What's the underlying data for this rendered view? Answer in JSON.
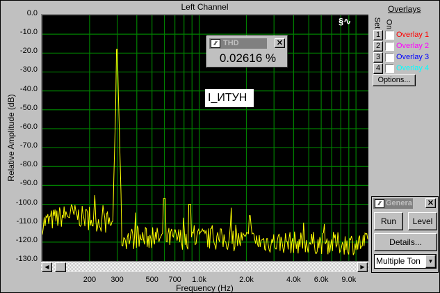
{
  "window": {
    "title": "Left Channel"
  },
  "axes": {
    "y_title": "Relative Amplitude (dB)",
    "x_title": "Frequency (Hz)",
    "y_ticks": [
      "0.0",
      "-10.0",
      "-20.0",
      "-30.0",
      "-40.0",
      "-50.0",
      "-60.0",
      "-70.0",
      "-80.0",
      "-90.0",
      "-100.0",
      "-110.0",
      "-120.0",
      "-130.0"
    ],
    "x_ticks": [
      "200",
      "300",
      "500",
      "700",
      "1.0k",
      "2.0k",
      "4.0k",
      "6.0k",
      "9.0k"
    ]
  },
  "thd": {
    "title": "THD",
    "value": "0.02616 %"
  },
  "marker_label": "I_ИТУН",
  "overlays": {
    "title": "Overlays",
    "set_label": "Set",
    "on_label": "On",
    "options_label": "Options...",
    "items": [
      {
        "num": "1",
        "name": "Overlay 1",
        "color": "#ff0000"
      },
      {
        "num": "2",
        "name": "Overlay 2",
        "color": "#ff00ff"
      },
      {
        "num": "3",
        "name": "Overlay 3",
        "color": "#0000ff"
      },
      {
        "num": "4",
        "name": "Overlay 4",
        "color": "#00ffff"
      }
    ]
  },
  "generator": {
    "title": "Genera",
    "run": "Run",
    "level": "Level",
    "details": "Details...",
    "waveform": "Multiple Ton"
  },
  "chart_data": {
    "type": "line",
    "title": "Left Channel",
    "xlabel": "Frequency (Hz)",
    "ylabel": "Relative Amplitude (dB)",
    "xscale": "log",
    "xlim": [
      100,
      12000
    ],
    "ylim": [
      -130,
      0
    ],
    "grid": true,
    "line_color": "#ffff00",
    "noise_floor": [
      [
        100,
        -110
      ],
      [
        150,
        -105
      ],
      [
        200,
        -108
      ],
      [
        280,
        -110
      ],
      [
        320,
        -118
      ],
      [
        1000,
        -118
      ],
      [
        3000,
        -120
      ],
      [
        12000,
        -121
      ]
    ],
    "peaks": [
      {
        "freq": 300,
        "db": -18
      },
      {
        "freq": 295,
        "db": -55
      },
      {
        "freq": 600,
        "db": -97
      },
      {
        "freq": 870,
        "db": -100
      },
      {
        "freq": 2100,
        "db": -106
      }
    ]
  }
}
